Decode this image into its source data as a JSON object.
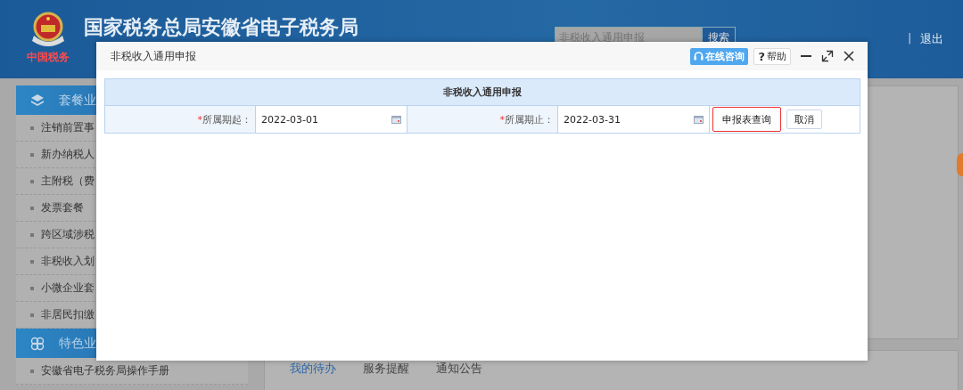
{
  "header": {
    "logo_text": "中国税务",
    "title": "国家税务总局安徽省电子税务局",
    "search": {
      "placeholder": "非税收入通用申报",
      "button": "搜索"
    },
    "separator": "|",
    "logout": "退出"
  },
  "sidebar": {
    "sections": [
      {
        "kind": "layers",
        "title": "套餐业",
        "items": [
          "注销前置事",
          "新办纳税人",
          "主附税（费",
          "发票套餐",
          "跨区域涉税",
          "非税收入划",
          "小微企业套",
          "非居民扣缴"
        ]
      },
      {
        "kind": "clover",
        "title": "特色业",
        "items": [
          "安徽省电子税务局操作手册"
        ]
      }
    ]
  },
  "content": {
    "tabs": [
      {
        "label": "我的待办",
        "selected": true
      },
      {
        "label": "服务提醒",
        "selected": false
      },
      {
        "label": "通知公告",
        "selected": false
      }
    ]
  },
  "dialog": {
    "title": "非税收入通用申报",
    "online_help": "在线咨询",
    "help": {
      "glyph": "?",
      "label": "帮助"
    },
    "form": {
      "title": "非税收入通用申报",
      "required_mark": "*",
      "fields": [
        {
          "label": "所属期起：",
          "required": true,
          "value": "2022-03-01"
        },
        {
          "label": "所属期止：",
          "required": true,
          "value": "2022-03-31"
        }
      ],
      "buttons": [
        {
          "label": "申报表查询",
          "highlighted": true
        },
        {
          "label": "取消",
          "highlighted": false
        }
      ]
    }
  }
}
